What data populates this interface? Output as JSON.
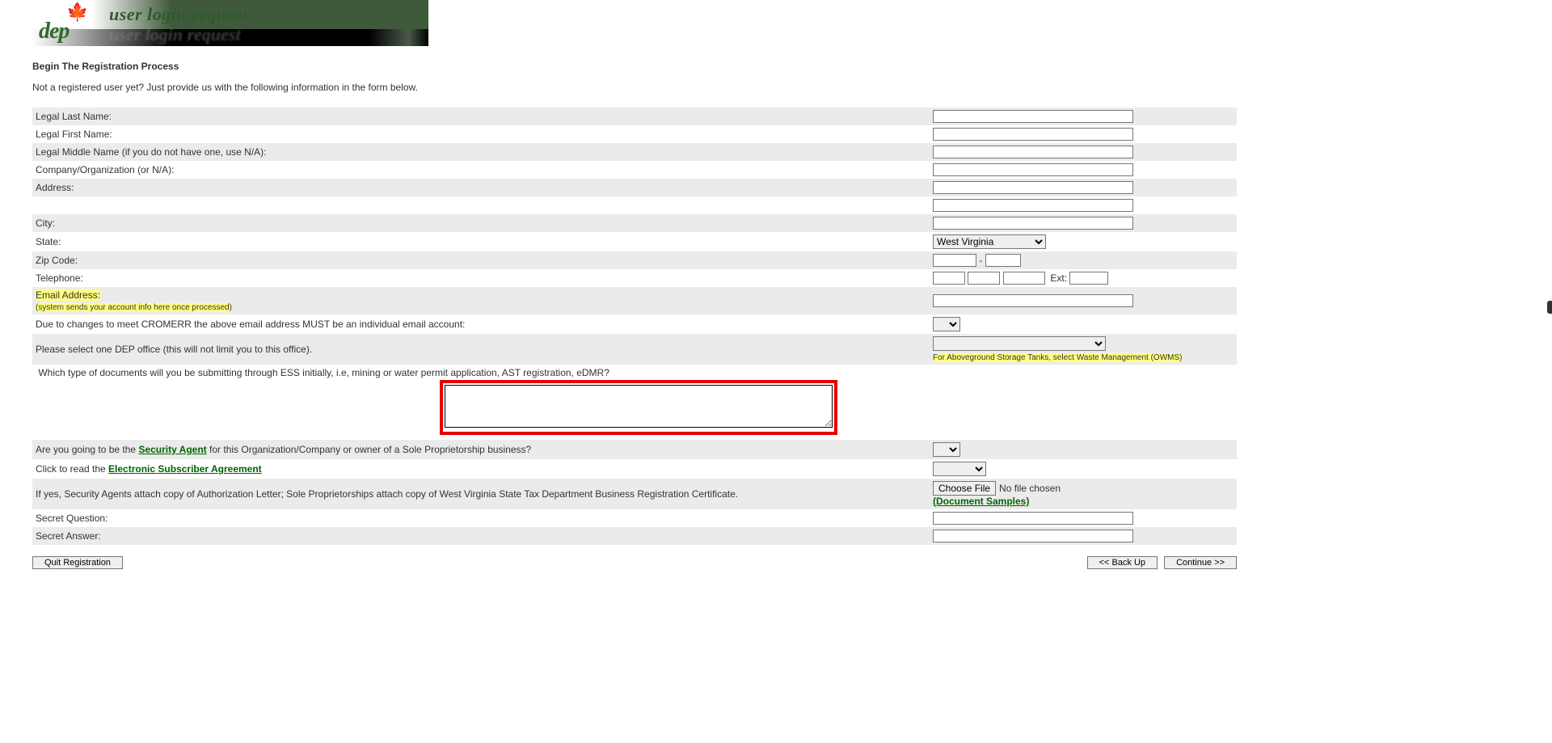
{
  "header": {
    "logo_text": "dep",
    "banner_title": "user login request"
  },
  "intro": {
    "title": "Begin The Registration Process",
    "subtitle": "Not a registered user yet? Just provide us with the following information in the form below."
  },
  "form": {
    "last_name": {
      "label": "Legal Last Name:",
      "value": ""
    },
    "first_name": {
      "label": "Legal First Name:",
      "value": ""
    },
    "middle_name": {
      "label": "Legal Middle Name (if you do not have one, use N/A):",
      "value": ""
    },
    "company": {
      "label": "Company/Organization (or N/A):",
      "value": ""
    },
    "address": {
      "label": "Address:",
      "value": ""
    },
    "address2": {
      "label": "",
      "value": ""
    },
    "city": {
      "label": "City:",
      "value": ""
    },
    "state": {
      "label": "State:",
      "selected": "West Virginia"
    },
    "zip": {
      "label": "Zip Code:",
      "sep": "-",
      "part1": "",
      "part2": ""
    },
    "telephone": {
      "label": "Telephone:",
      "ext_label": "Ext:",
      "p1": "",
      "p2": "",
      "p3": "",
      "ext": ""
    },
    "email": {
      "label": "Email Address:",
      "note": "(system sends your account info here once processed)",
      "value": ""
    },
    "cromerr": {
      "label": "Due to changes to meet CROMERR the above email address MUST be an individual email account:"
    },
    "office": {
      "label": "Please select one DEP office (this will not limit you to this office).",
      "note": "For Aboveground Storage Tanks, select Waste Management (OWMS)"
    },
    "documents": {
      "label": "Which type of documents will you be submitting through ESS initially, i.e, mining or water permit application, AST registration, eDMR?",
      "value": ""
    },
    "security_agent": {
      "prefix": "Are you going to be the ",
      "link": "Security Agent",
      "suffix": " for this Organization/Company or owner of a Sole Proprietorship business?"
    },
    "esa": {
      "prefix": "Click to read the ",
      "link": "Electronic Subscriber Agreement"
    },
    "attach": {
      "text": "If yes, Security Agents attach copy of Authorization Letter; Sole Proprietorships attach copy of West Virginia State Tax Department Business Registration Certificate.",
      "btn": "Choose File",
      "status": "No file chosen",
      "samples": "(Document Samples)"
    },
    "secret_q": {
      "label": "Secret Question:",
      "value": ""
    },
    "secret_a": {
      "label": "Secret Answer:",
      "value": ""
    }
  },
  "buttons": {
    "quit": "Quit Registration",
    "back": "<< Back Up",
    "continue": "Continue >>"
  }
}
